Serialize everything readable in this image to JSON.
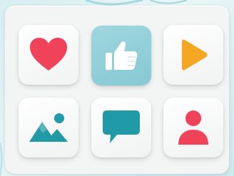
{
  "grid": {
    "tiles": [
      {
        "icon": "heart-icon",
        "color": "#f0435a",
        "active": false
      },
      {
        "icon": "thumbs-up-icon",
        "color": "#ffffff",
        "active": true
      },
      {
        "icon": "play-icon",
        "color": "#f5a623",
        "active": false
      },
      {
        "icon": "image-icon",
        "color": "#1f9aa6",
        "active": false
      },
      {
        "icon": "chat-bubble-icon",
        "color": "#1f9aa6",
        "active": false
      },
      {
        "icon": "user-icon",
        "color": "#f0435a",
        "active": false
      }
    ]
  },
  "colors": {
    "accent_teal": "#1f9aa6",
    "accent_red": "#f0435a",
    "accent_orange": "#f5a623",
    "active_tile": "#92cfd9"
  }
}
